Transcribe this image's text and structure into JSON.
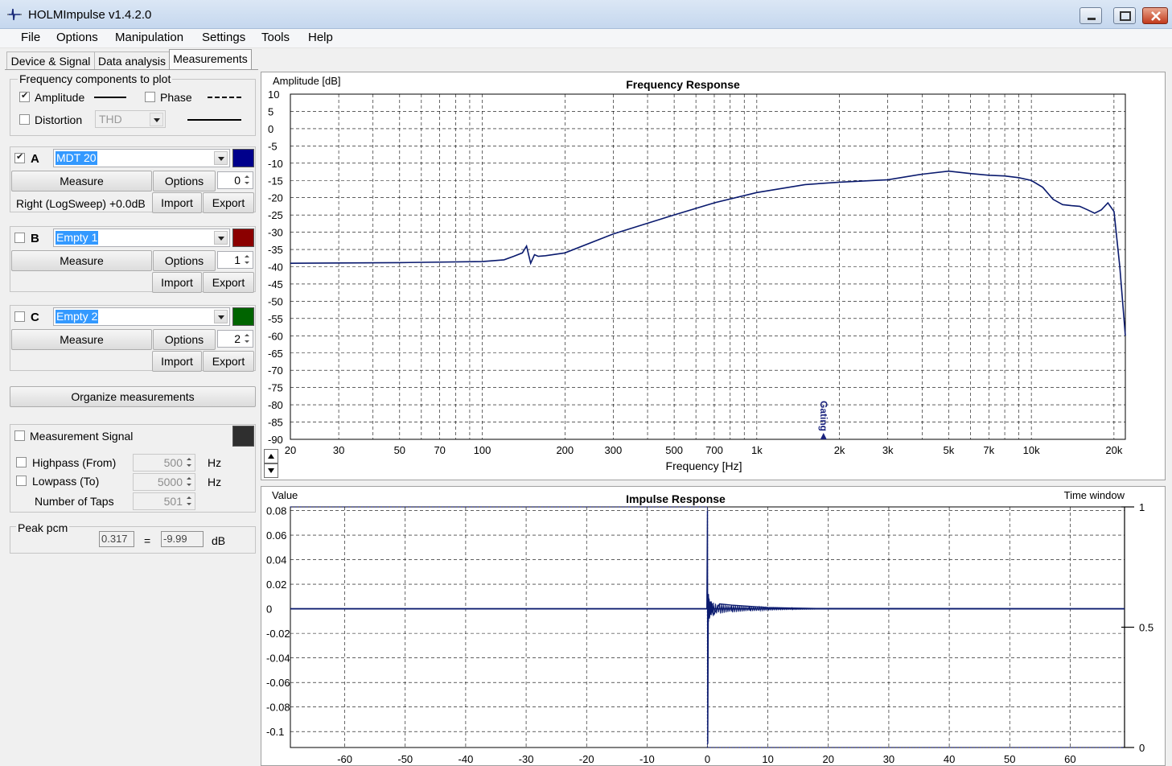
{
  "window": {
    "title": "HOLMImpulse  v1.4.2.0"
  },
  "menu": [
    "File",
    "Options",
    "Manipulation",
    "Settings",
    "Tools",
    "Help"
  ],
  "tabs": [
    "Device & Signal",
    "Data analysis",
    "Measurements"
  ],
  "freq_components": {
    "title": "Frequency components to plot",
    "amplitude_label": "Amplitude",
    "amplitude_checked": true,
    "phase_label": "Phase",
    "phase_checked": false,
    "distortion_label": "Distortion",
    "distortion_checked": false,
    "distortion_value": "THD"
  },
  "channels": [
    {
      "letter": "A",
      "checked": true,
      "name": "MDT 20",
      "color": "#00008b",
      "measure": "Measure",
      "options": "Options",
      "spin": "0",
      "info": "Right (LogSweep) +0.0dB",
      "import": "Import",
      "export": "Export"
    },
    {
      "letter": "B",
      "checked": false,
      "name": "Empty 1",
      "color": "#8b0000",
      "measure": "Measure",
      "options": "Options",
      "spin": "1",
      "info": "",
      "import": "Import",
      "export": "Export"
    },
    {
      "letter": "C",
      "checked": false,
      "name": "Empty 2",
      "color": "#006400",
      "measure": "Measure",
      "options": "Options",
      "spin": "2",
      "info": "",
      "import": "Import",
      "export": "Export"
    }
  ],
  "organize_label": "Organize measurements",
  "signal": {
    "title": "Measurement Signal",
    "checked": false,
    "swatch_color": "#2f2f2f",
    "highpass_label": "Highpass (From)",
    "highpass_value": "500",
    "highpass_unit": "Hz",
    "lowpass_label": "Lowpass (To)",
    "lowpass_value": "5000",
    "lowpass_unit": "Hz",
    "taps_label": "Number of Taps",
    "taps_value": "501"
  },
  "peak": {
    "title": "Peak pcm",
    "pcm_value": "0.317",
    "equals": "=",
    "db_value": "-9.99",
    "unit": "dB"
  },
  "freq_chart": {
    "title": "Frequency Response",
    "ylabel": "Amplitude [dB]",
    "xlabel": "Frequency [Hz]",
    "y_ticks": [
      "10",
      "5",
      "0",
      "-5",
      "-10",
      "-15",
      "-20",
      "-25",
      "-30",
      "-35",
      "-40",
      "-45",
      "-50",
      "-55",
      "-60",
      "-65",
      "-70",
      "-75",
      "-80",
      "-85",
      "-90"
    ],
    "x_ticks": [
      {
        "f": 20,
        "label": "20"
      },
      {
        "f": 30,
        "label": "30"
      },
      {
        "f": 50,
        "label": "50"
      },
      {
        "f": 70,
        "label": "70"
      },
      {
        "f": 100,
        "label": "100"
      },
      {
        "f": 200,
        "label": "200"
      },
      {
        "f": 300,
        "label": "300"
      },
      {
        "f": 500,
        "label": "500"
      },
      {
        "f": 700,
        "label": "700"
      },
      {
        "f": 1000,
        "label": "1k"
      },
      {
        "f": 2000,
        "label": "2k"
      },
      {
        "f": 3000,
        "label": "3k"
      },
      {
        "f": 5000,
        "label": "5k"
      },
      {
        "f": 7000,
        "label": "7k"
      },
      {
        "f": 10000,
        "label": "10k"
      },
      {
        "f": 20000,
        "label": "20k"
      }
    ],
    "gating_label": "Gating",
    "gating_freq": 1750
  },
  "impulse_chart": {
    "title": "Impulse Response",
    "ylabel": "Value",
    "right_label": "Time window",
    "y_ticks": [
      "0.08",
      "0.06",
      "0.04",
      "0.02",
      "0",
      "-0.02",
      "-0.04",
      "-0.06",
      "-0.08",
      "-0.1"
    ],
    "x_ticks": [
      "-60",
      "-50",
      "-40",
      "-30",
      "-20",
      "-10",
      "0",
      "10",
      "20",
      "30",
      "40",
      "50",
      "60"
    ],
    "right_ticks": [
      "1",
      "0.5",
      "0"
    ]
  },
  "chart_data": [
    {
      "type": "line",
      "title": "Frequency Response",
      "xlabel": "Frequency [Hz]",
      "ylabel": "Amplitude [dB]",
      "x_scale": "log",
      "xlim": [
        20,
        22000
      ],
      "ylim": [
        -90,
        10
      ],
      "grid": true,
      "series": [
        {
          "name": "MDT 20",
          "color": "#0a1a6e",
          "x": [
            20,
            50,
            100,
            120,
            130,
            140,
            145,
            150,
            155,
            160,
            170,
            200,
            300,
            500,
            700,
            1000,
            1500,
            2000,
            3000,
            4000,
            5000,
            6000,
            7000,
            8000,
            9000,
            10000,
            11000,
            12000,
            13000,
            14000,
            15000,
            16000,
            17000,
            18000,
            19000,
            20000,
            21000,
            22000
          ],
          "y": [
            -39,
            -38.8,
            -38.5,
            -38,
            -37,
            -36,
            -34,
            -39,
            -36.5,
            -37,
            -36.8,
            -36,
            -30.5,
            -25,
            -21.5,
            -18.5,
            -16.2,
            -15.5,
            -14.8,
            -13.2,
            -12.3,
            -13,
            -13.5,
            -13.7,
            -14.2,
            -15,
            -17,
            -20.5,
            -22,
            -22.3,
            -22.5,
            -23.5,
            -24.5,
            -23.5,
            -21.5,
            -24,
            -40,
            -60
          ]
        }
      ]
    },
    {
      "type": "line",
      "title": "Impulse Response",
      "xlabel": "",
      "ylabel": "Value",
      "xlim": [
        -69,
        69
      ],
      "ylim": [
        -0.113,
        0.083
      ],
      "grid": true,
      "series": [
        {
          "name": "MDT 20",
          "color": "#0a1a6e",
          "x": [
            -69,
            -0.1,
            0,
            0.05,
            0.15,
            0.3,
            0.6,
            1,
            2,
            4,
            7,
            10,
            14,
            18,
            69
          ],
          "y": [
            0,
            0,
            0.08,
            -0.11,
            0.012,
            -0.008,
            0.006,
            -0.005,
            0.004,
            0.003,
            0.002,
            0.001,
            0.0006,
            0.0003,
            0
          ]
        }
      ]
    }
  ]
}
